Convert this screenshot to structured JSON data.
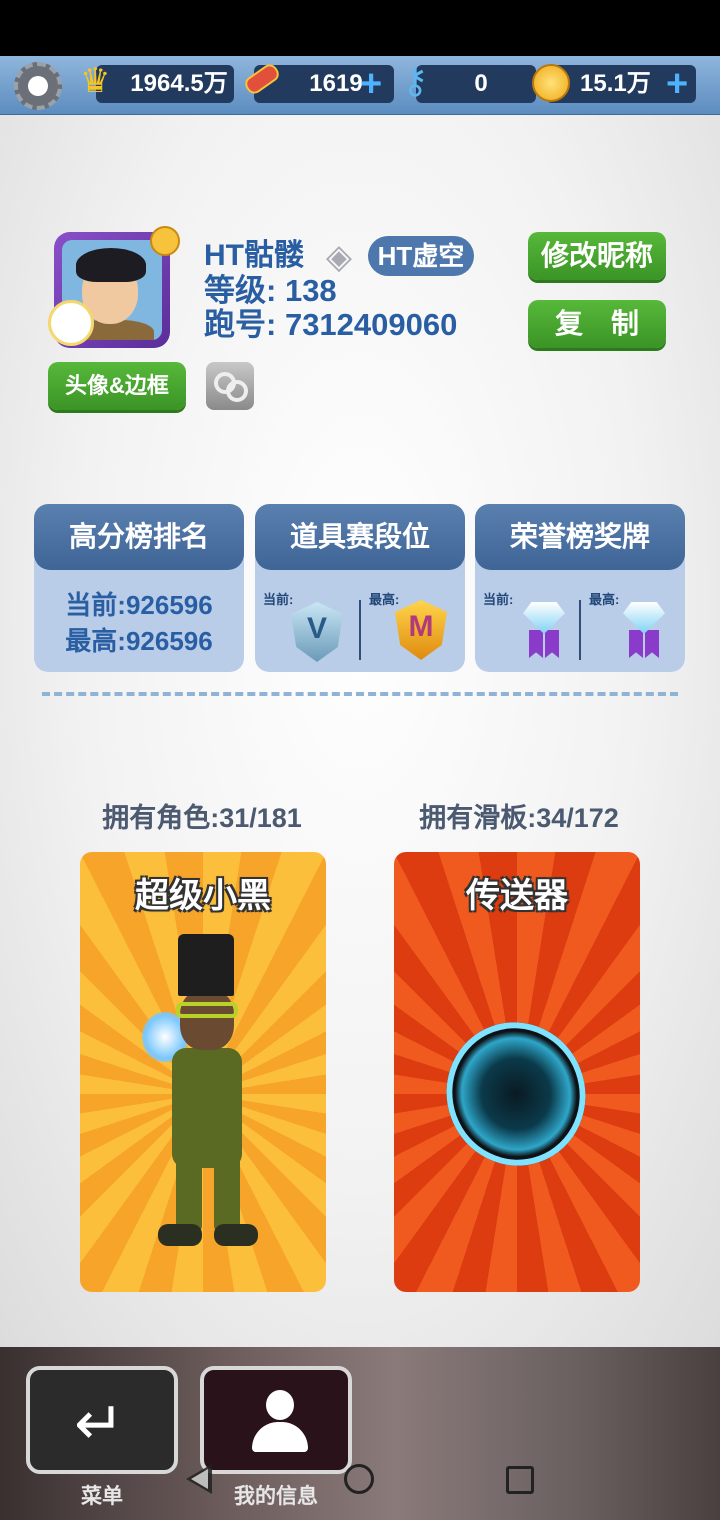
{
  "topbar": {
    "score_value": "1964.5万",
    "boards_value": "1619",
    "keys_value": "0",
    "coins_value": "15.1万",
    "plus": "+",
    "icons": {
      "settings": "gear-icon",
      "score": "crown-icon",
      "boards": "hoverboard-icon",
      "keys": "key-icon",
      "coins": "coin-icon"
    }
  },
  "profile": {
    "username": "HT骷髅",
    "tag": "HT虚空",
    "level_label": "等级:",
    "level_value": "138",
    "id_label": "跑号:",
    "id_value": "7312409060",
    "rename_button": "修改昵称",
    "copy_button": "复　制",
    "avatar_frame_button": "头像&边框"
  },
  "stats": {
    "leaderboard": {
      "title": "高分榜排名",
      "current": "当前:926596",
      "best": "最高:926596"
    },
    "item_league": {
      "title": "道具赛段位",
      "current_label": "当前:",
      "best_label": "最高:",
      "current_rank": "V",
      "best_rank": "M"
    },
    "honor": {
      "title": "荣誉榜奖牌",
      "current_label": "当前:",
      "best_label": "最高:"
    }
  },
  "collection": {
    "characters_label": "拥有角色:31/181",
    "boards_label": "拥有滑板:34/172",
    "character_name": "超级小黑",
    "board_name": "传送器"
  },
  "nav": {
    "menu_label": "菜单",
    "info_label": "我的信息",
    "menu_icon": "return-icon",
    "info_icon": "person-icon"
  },
  "colors": {
    "accent_blue": "#2a5ea3",
    "button_green": "#3b9426",
    "character_card": "#fbbf3c",
    "board_card": "#dc3c10"
  }
}
